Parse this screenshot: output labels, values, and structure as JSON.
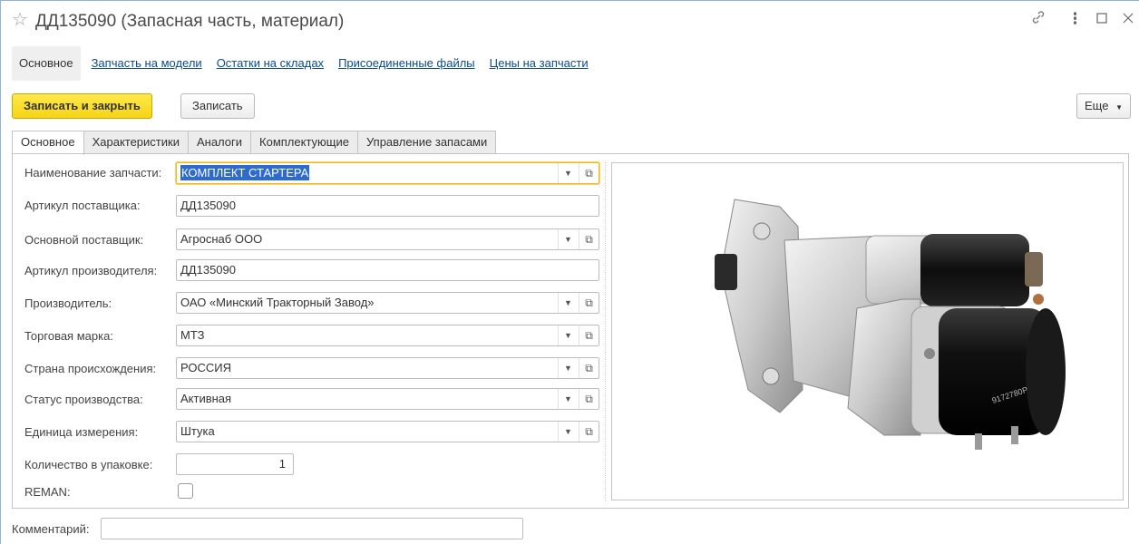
{
  "window": {
    "title": "ДД135090 (Запасная часть, материал)",
    "star_icon": "star-icon",
    "controls": [
      "link-icon",
      "more-icon",
      "maximize-icon",
      "close-icon"
    ]
  },
  "nav": {
    "items": [
      {
        "label": "Основное",
        "active": true
      },
      {
        "label": "Запчасть на модели"
      },
      {
        "label": "Остатки на складах"
      },
      {
        "label": "Присоединенные файлы"
      },
      {
        "label": "Цены на запчасти"
      }
    ]
  },
  "toolbar": {
    "save_close_label": "Записать и закрыть",
    "save_label": "Записать",
    "more_label": "Еще",
    "primary_color": "#f5d416"
  },
  "tabs": [
    {
      "label": "Основное",
      "active": true
    },
    {
      "label": "Характеристики"
    },
    {
      "label": "Аналоги"
    },
    {
      "label": "Комплектующие"
    },
    {
      "label": "Управление запасами"
    }
  ],
  "form": {
    "part_name": {
      "label": "Наименование запчасти:",
      "value": "КОМПЛЕКТ СТАРТЕРА"
    },
    "supplier_article": {
      "label": "Артикул поставщика:",
      "value": "ДД135090"
    },
    "main_supplier": {
      "label": "Основной поставщик:",
      "value": "Агроснаб ООО"
    },
    "manufacturer_article": {
      "label": "Артикул производителя:",
      "value": "ДД135090"
    },
    "manufacturer": {
      "label": "Производитель:",
      "value": "ОАО «Минский Тракторный Завод»"
    },
    "brand": {
      "label": "Торговая марка:",
      "value": "МТЗ"
    },
    "country": {
      "label": "Страна происхождения:",
      "value": "РОССИЯ"
    },
    "status": {
      "label": "Статус производства:",
      "value": "Активная"
    },
    "unit": {
      "label": "Единица измерения:",
      "value": "Штука"
    },
    "qty_pack": {
      "label": "Количество в упаковке:",
      "value": "1"
    },
    "reman": {
      "label": "REMAN:",
      "checked": false
    },
    "comment": {
      "label": "Комментарий:",
      "value": ""
    }
  },
  "image": {
    "subject": "starter-motor",
    "label_text": "9172780P"
  }
}
